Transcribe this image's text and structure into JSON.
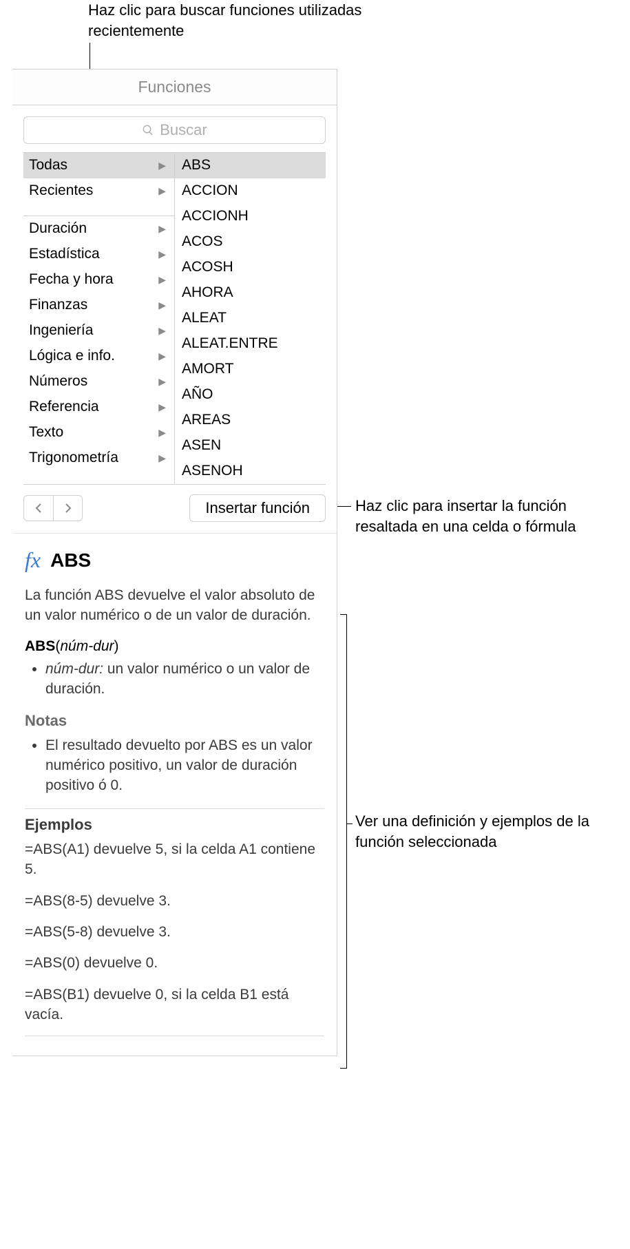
{
  "callouts": {
    "top": "Haz clic para buscar funciones utilizadas recientemente",
    "insert": "Haz clic para insertar la función resaltada en una celda o fórmula",
    "detail": "Ver una definición y ejemplos de la función seleccionada"
  },
  "panel": {
    "title": "Funciones",
    "search_placeholder": "Buscar",
    "categories": [
      {
        "label": "Todas",
        "selected": true
      },
      {
        "label": "Recientes"
      },
      {
        "spacer": true
      },
      {
        "label": "Duración"
      },
      {
        "label": "Estadística"
      },
      {
        "label": "Fecha y hora"
      },
      {
        "label": "Finanzas"
      },
      {
        "label": "Ingeniería"
      },
      {
        "label": "Lógica e info."
      },
      {
        "label": "Números"
      },
      {
        "label": "Referencia"
      },
      {
        "label": "Texto"
      },
      {
        "label": "Trigonometría"
      }
    ],
    "functions": [
      {
        "label": "ABS",
        "selected": true
      },
      {
        "label": "ACCION"
      },
      {
        "label": "ACCIONH"
      },
      {
        "label": "ACOS"
      },
      {
        "label": "ACOSH"
      },
      {
        "label": "AHORA"
      },
      {
        "label": "ALEAT"
      },
      {
        "label": "ALEAT.ENTRE"
      },
      {
        "label": "AMORT"
      },
      {
        "label": "AÑO"
      },
      {
        "label": "AREAS"
      },
      {
        "label": "ASEN"
      },
      {
        "label": "ASENOH"
      }
    ],
    "insert_label": "Insertar función"
  },
  "detail": {
    "fx": "fx",
    "name": "ABS",
    "description": "La función ABS devuelve el valor absoluto de un valor numérico o de un valor de duración.",
    "syntax_fn": "ABS",
    "syntax_arg": "núm-dur",
    "param_name": "núm-dur:",
    "param_desc": " un valor numérico o un valor de duración.",
    "notes_head": "Notas",
    "notes": [
      "El resultado devuelto por ABS es un valor numérico positivo, un valor de duración positivo ó 0."
    ],
    "examples_head": "Ejemplos",
    "examples": [
      "=ABS(A1) devuelve 5, si la celda A1 contiene 5.",
      "=ABS(8-5) devuelve 3.",
      "=ABS(5-8) devuelve 3.",
      "=ABS(0) devuelve 0.",
      "=ABS(B1) devuelve 0, si la celda B1 está vacía."
    ]
  }
}
